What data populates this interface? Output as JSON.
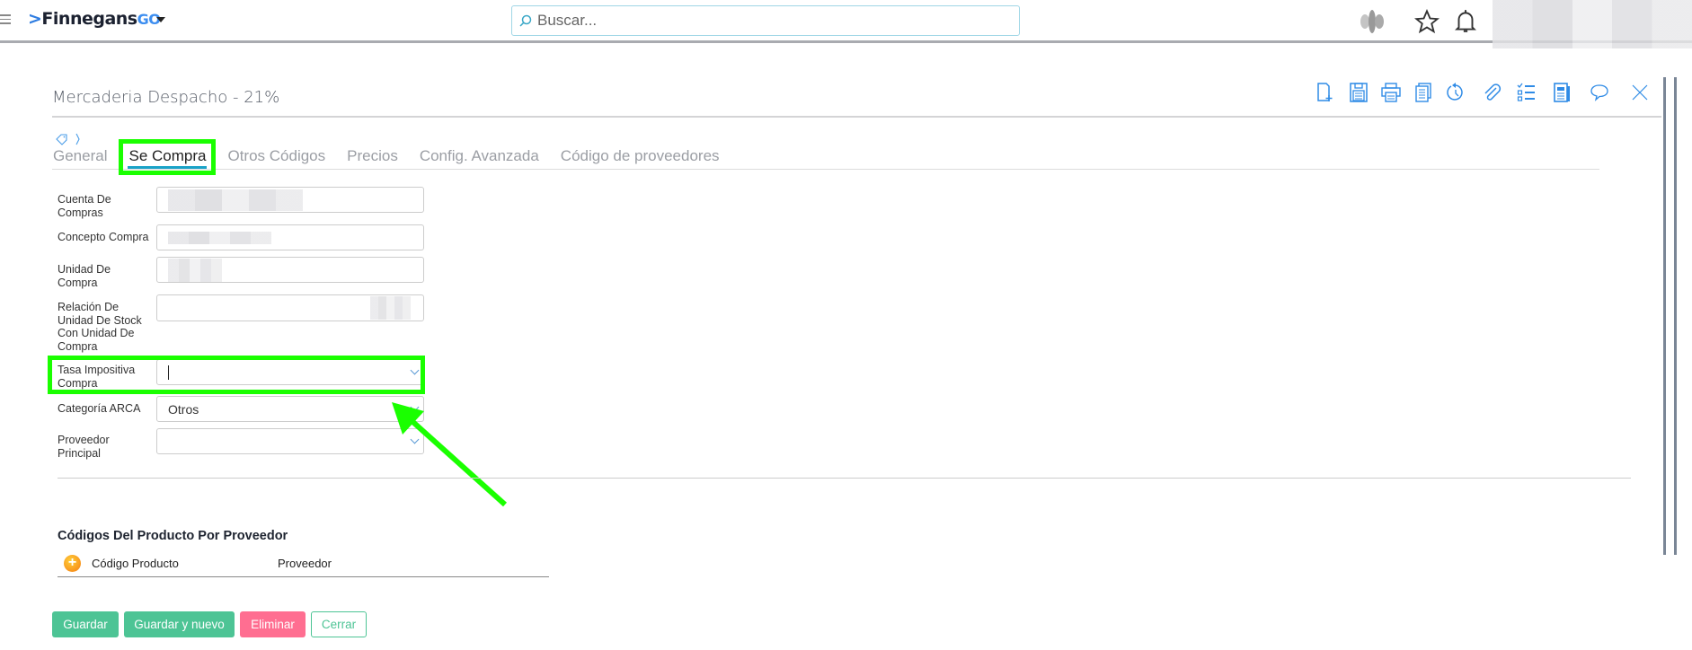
{
  "header": {
    "logo_text": "Finnegans",
    "logo_suffix": "GO",
    "search_placeholder": "Buscar..."
  },
  "page": {
    "title": "Mercaderia Despacho - 21%"
  },
  "toolbar": [
    "new-document",
    "save",
    "print",
    "copy",
    "history",
    "attach",
    "checklist",
    "report",
    "comment",
    "close"
  ],
  "tabs": [
    {
      "label": "General",
      "active": false
    },
    {
      "label": "Se Compra",
      "active": true
    },
    {
      "label": "Otros Códigos",
      "active": false
    },
    {
      "label": "Precios",
      "active": false
    },
    {
      "label": "Config. Avanzada",
      "active": false
    },
    {
      "label": "Código de proveedores",
      "active": false
    }
  ],
  "form": {
    "cuenta_compras": {
      "label": "Cuenta De Compras"
    },
    "concepto_compra": {
      "label": "Concepto Compra"
    },
    "unidad_compra": {
      "label": "Unidad De Compra"
    },
    "relacion_unidad": {
      "label": "Relación De Unidad De Stock Con Unidad De Compra"
    },
    "tasa_impositiva": {
      "label": "Tasa Impositiva Compra",
      "value": ""
    },
    "categoria_arca": {
      "label": "Categoría ARCA",
      "value": "Otros"
    },
    "proveedor_principal": {
      "label": "Proveedor Principal",
      "value": ""
    }
  },
  "codigos": {
    "title": "Códigos Del Producto Por Proveedor",
    "columns": [
      "Código Producto",
      "Proveedor"
    ]
  },
  "buttons": {
    "guardar": "Guardar",
    "guardar_nuevo": "Guardar y nuevo",
    "eliminar": "Eliminar",
    "cerrar": "Cerrar"
  },
  "colors": {
    "accent": "#2f8be6",
    "save": "#4dc495",
    "delete": "#ff6e91",
    "highlight": "#1aff00"
  }
}
